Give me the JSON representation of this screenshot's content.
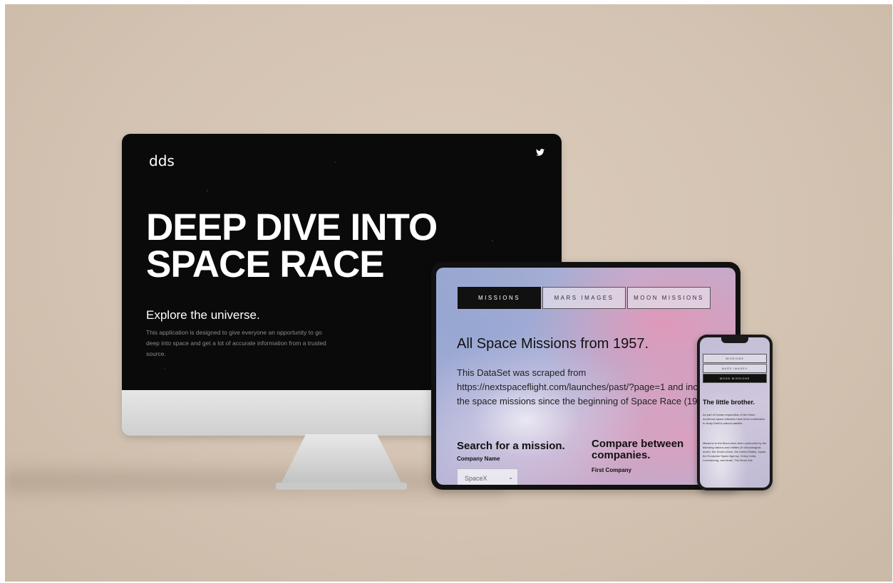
{
  "desktop": {
    "logo": "dds",
    "hero_title": "DEEP DIVE INTO SPACE RACE",
    "hero_subtitle": "Explore the universe.",
    "hero_description": "This application is designed to give everyone an opportunity to go deep into space and get a lot of accurate information from a trusted source."
  },
  "tablet": {
    "tabs": [
      {
        "label": "MISSIONS"
      },
      {
        "label": "MARS IMAGES"
      },
      {
        "label": "MOON MISSIONS"
      }
    ],
    "title": "All Space Missions from 1957.",
    "description": "This DataSet was scraped from https://nextspaceflight.com/launches/past/?page=1 and includes all the space missions since the beginning of Space Race (1957)",
    "search_heading": "Search for a mission.",
    "company_label": "Company Name",
    "company_value": "SpaceX",
    "compare_heading": "Compare between companies.",
    "first_company_label": "First Company"
  },
  "phone": {
    "tabs": [
      {
        "label": "MISSIONS"
      },
      {
        "label": "MARS IMAGES"
      },
      {
        "label": "MOON MISSIONS"
      }
    ],
    "title": "The little brother.",
    "paragraph1": "As part of human exploration of the Moon, numerous space missions have been undertaken to study Earth's natural satellite.",
    "paragraph2": "Missions to the Moon have been conducted by the following nations and entities (in chronological order): the Soviet Union, the United States, Japan, the European Space Agency, China, India, Luxembourg, and Israel. The Moon has"
  },
  "colors": {
    "background": "#d4c3b2",
    "screen": "#0a0a0a",
    "active_tab": "#111111"
  }
}
